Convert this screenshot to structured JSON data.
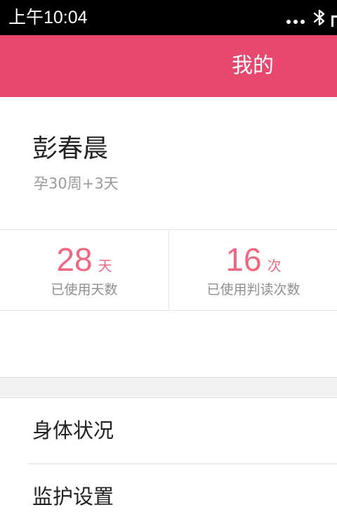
{
  "status_bar": {
    "time": "上午10:04",
    "icons": [
      "more-dots-icon",
      "bluetooth-icon",
      "signal-icon"
    ]
  },
  "header": {
    "title": "我的"
  },
  "profile": {
    "name": "彭春晨",
    "pregnancy": "孕30周+3天"
  },
  "stats": [
    {
      "value": "28",
      "unit": "天",
      "label": "已使用天数"
    },
    {
      "value": "16",
      "unit": "次",
      "label": "已使用判读次数"
    }
  ],
  "menu": [
    {
      "label": "身体状况"
    },
    {
      "label": "监护设置"
    }
  ],
  "colors": {
    "header_bg": "#e6486e",
    "accent": "#f0677f",
    "status_bar_bg": "#000000",
    "secondary_text": "#9a9a9a",
    "section_gap": "#f2f2f2"
  }
}
